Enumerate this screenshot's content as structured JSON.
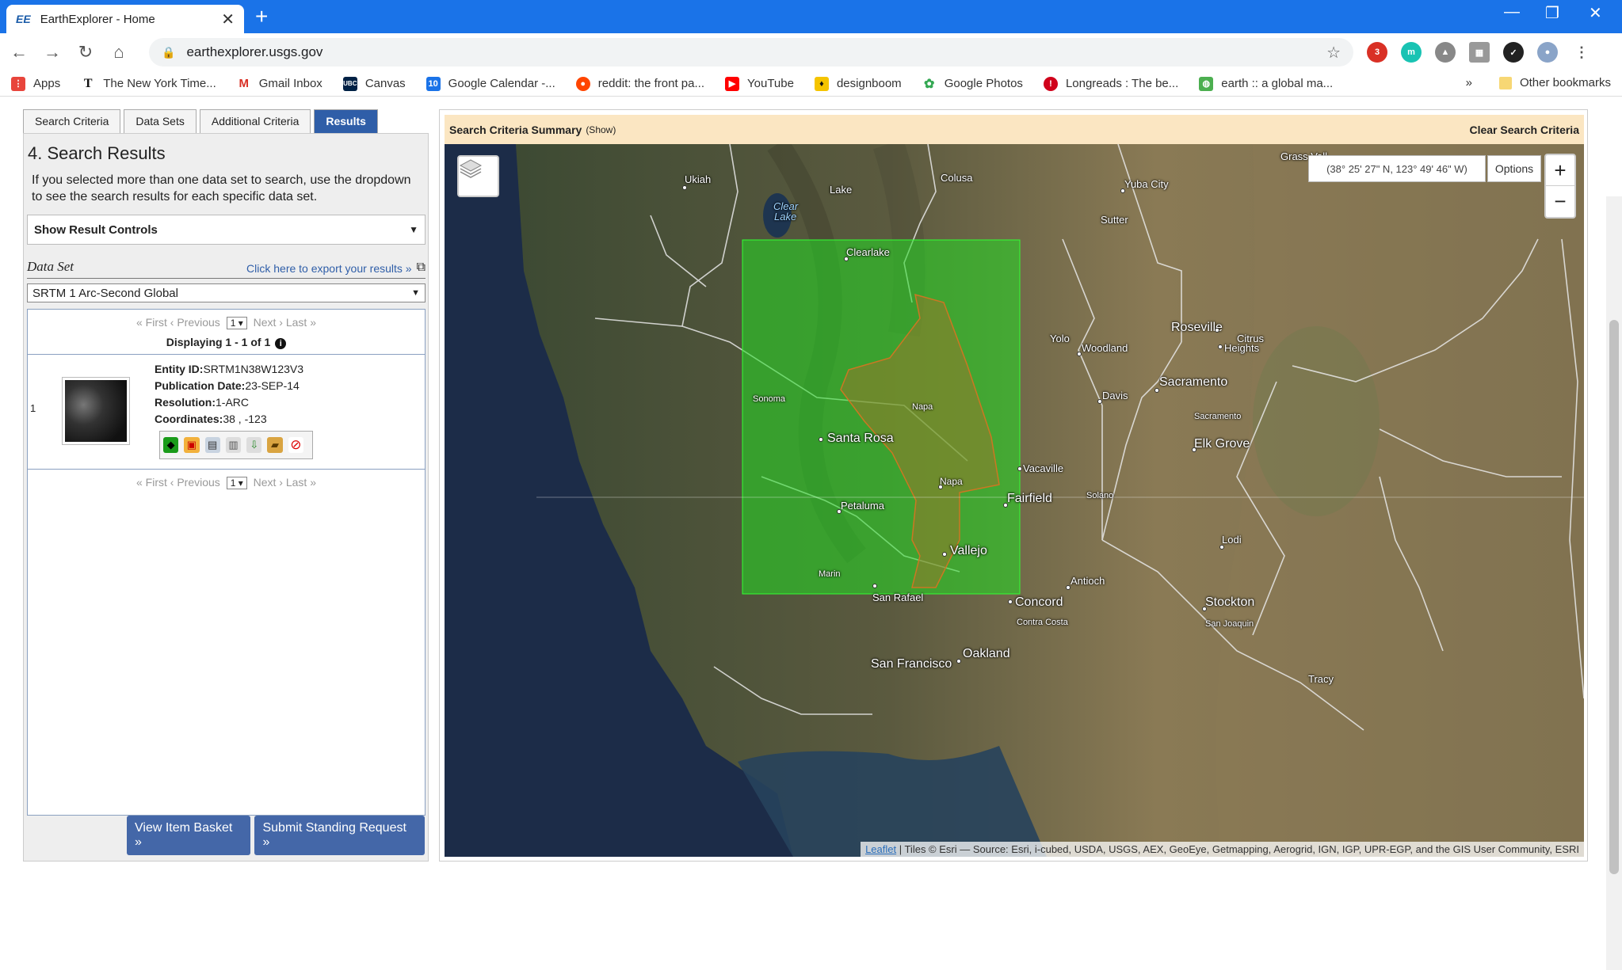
{
  "browser": {
    "tab_title": "EarthExplorer - Home",
    "tab_favicon": "EE",
    "url": "earthexplorer.usgs.gov",
    "bookmarks": [
      {
        "label": "Apps",
        "icon": "apps-grid-icon",
        "color": "#e8453c"
      },
      {
        "label": "The New York Time...",
        "icon": "nyt-icon",
        "color": "#111111"
      },
      {
        "label": "Gmail Inbox",
        "icon": "gmail-icon",
        "color": "#d93025"
      },
      {
        "label": "Canvas",
        "icon": "ubc-icon",
        "color": "#002145"
      },
      {
        "label": "Google Calendar -...",
        "icon": "calendar-icon",
        "color": "#1a73e8"
      },
      {
        "label": "reddit: the front pa...",
        "icon": "reddit-icon",
        "color": "#ff4500"
      },
      {
        "label": "YouTube",
        "icon": "youtube-icon",
        "color": "#ff0000"
      },
      {
        "label": "designboom",
        "icon": "designboom-icon",
        "color": "#f5c400"
      },
      {
        "label": "Google Photos",
        "icon": "photos-icon",
        "color": "#34a853"
      },
      {
        "label": "Longreads : The be...",
        "icon": "longreads-icon",
        "color": "#d0021b"
      },
      {
        "label": "earth :: a global ma...",
        "icon": "earth-icon",
        "color": "#4caf50"
      }
    ],
    "overflow": "»",
    "other_bookmarks": "Other bookmarks",
    "ext_badge": "3",
    "ext_m": "m"
  },
  "tabs": [
    "Search Criteria",
    "Data Sets",
    "Additional Criteria",
    "Results"
  ],
  "active_tab": "Results",
  "results": {
    "heading": "4. Search Results",
    "help": "If you selected more than one data set to search, use the dropdown to see the search results for each specific data set.",
    "result_controls": "Show Result Controls",
    "dataset_label": "Data Set",
    "export_link": "Click here to export your results »",
    "dataset_selected": "SRTM 1 Arc-Second Global",
    "pager": {
      "first": "« First",
      "previous": "‹ Previous",
      "page": "1",
      "next": "Next ›",
      "last": "Last »"
    },
    "displaying": "Displaying 1 - 1 of 1",
    "row_index": "1",
    "entity_label": "Entity ID:",
    "entity_value": "SRTM1N38W123V3",
    "pubdate_label": "Publication Date:",
    "pubdate_value": "23-SEP-14",
    "resolution_label": "Resolution:",
    "resolution_value": "1-ARC",
    "coords_label": "Coordinates:",
    "coords_value": "38 , -123",
    "view_basket": "View Item Basket »",
    "standing_request": "Submit Standing Request »"
  },
  "map": {
    "summary_title": "Search Criteria Summary",
    "summary_show": "(Show)",
    "clear": "Clear Search Criteria",
    "coords": "(38° 25' 27\" N, 123° 49' 46\" W)",
    "options": "Options",
    "zoom_in": "+",
    "zoom_out": "−",
    "attribution_link": "Leaflet",
    "attribution_text": " | Tiles © Esri — Source: Esri, i-cubed, USDA, USGS, AEX, GeoEye, Getmapping, Aerogrid, IGN, IGP, UPR-EGP, and the GIS User Community, ESRI",
    "labels": {
      "ukiah": "Ukiah",
      "lake": "Lake",
      "colusa": "Colusa",
      "yuba": "Yuba City",
      "sutter": "Sutter",
      "clear_lake_1": "Clear",
      "clear_lake_2": "Lake",
      "clearlake": "Clearlake",
      "yolo": "Yolo",
      "woodland": "Woodland",
      "roseville": "Roseville",
      "citrus": "Citrus",
      "heights": "Heights",
      "sacramento": "Sacramento",
      "sacramento_county": "Sacramento",
      "davis": "Davis",
      "elkgrove": "Elk Grove",
      "napa_county": "Napa",
      "sonoma": "Sonoma",
      "santarosa": "Santa Rosa",
      "vacaville": "Vacaville",
      "napa": "Napa",
      "fairfield": "Fairfield",
      "solano": "Solano",
      "petaluma": "Petaluma",
      "vallejo": "Vallejo",
      "lodi": "Lodi",
      "marin": "Marin",
      "sanrafael": "San Rafael",
      "antioch": "Antioch",
      "concord": "Concord",
      "stockton": "Stockton",
      "contracosta": "Contra Costa",
      "sanjoaquin": "San Joaquin",
      "oakland": "Oakland",
      "sanfrancisco": "San Francisco",
      "grasvalley": "Grass Vall",
      "tracy": "Tracy"
    }
  }
}
